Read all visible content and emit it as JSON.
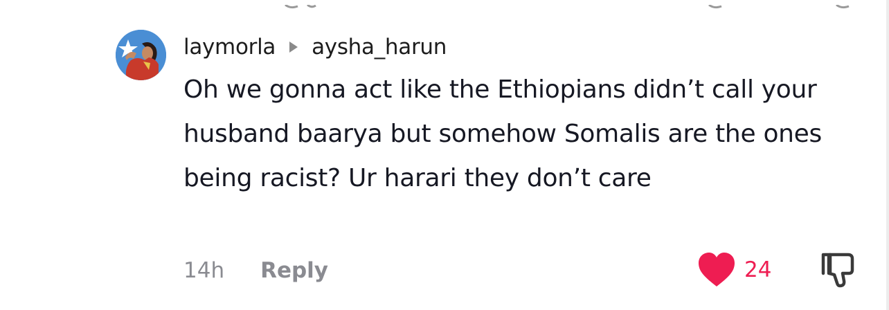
{
  "comment": {
    "username": "laymorla",
    "reply_to": "aysha_harun",
    "text": "Oh we gonna act like the Ethiopians didn’t call your husband baarya but somehow Somalis are the ones being racist? Ur harari they don’t care",
    "time": "14h",
    "reply_label": "Reply",
    "like_count": "24"
  },
  "colors": {
    "like": "#ee1d52",
    "muted": "#8a8b91",
    "text": "#161823"
  },
  "icons": {
    "avatar": "avatar",
    "reply_arrow": "reply-arrow-icon",
    "like": "heart-icon",
    "dislike": "thumbs-down-icon"
  }
}
